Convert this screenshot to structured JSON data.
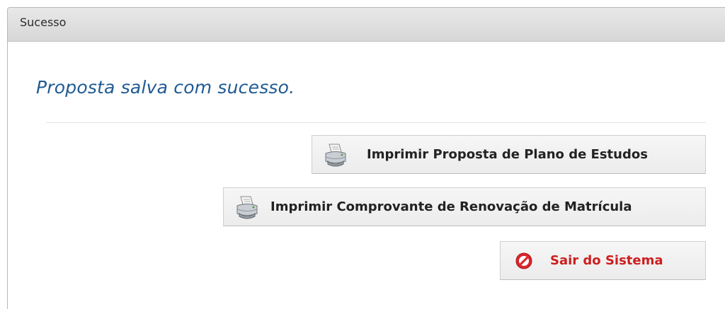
{
  "dialog": {
    "title": "Sucesso",
    "message": "Proposta salva com sucesso.",
    "buttons": {
      "print_plan": {
        "label": "Imprimir Proposta de Plano de Estudos",
        "icon": "printer-icon"
      },
      "print_receipt": {
        "label": "Imprimir Comprovante de Renovação de Matrícula",
        "icon": "printer-icon"
      },
      "exit": {
        "label": "Sair do Sistema",
        "icon": "no-entry-icon"
      }
    }
  },
  "colors": {
    "message": "#1f5a93",
    "exit_text": "#cc1f1f",
    "exit_icon": "#d8262c"
  }
}
